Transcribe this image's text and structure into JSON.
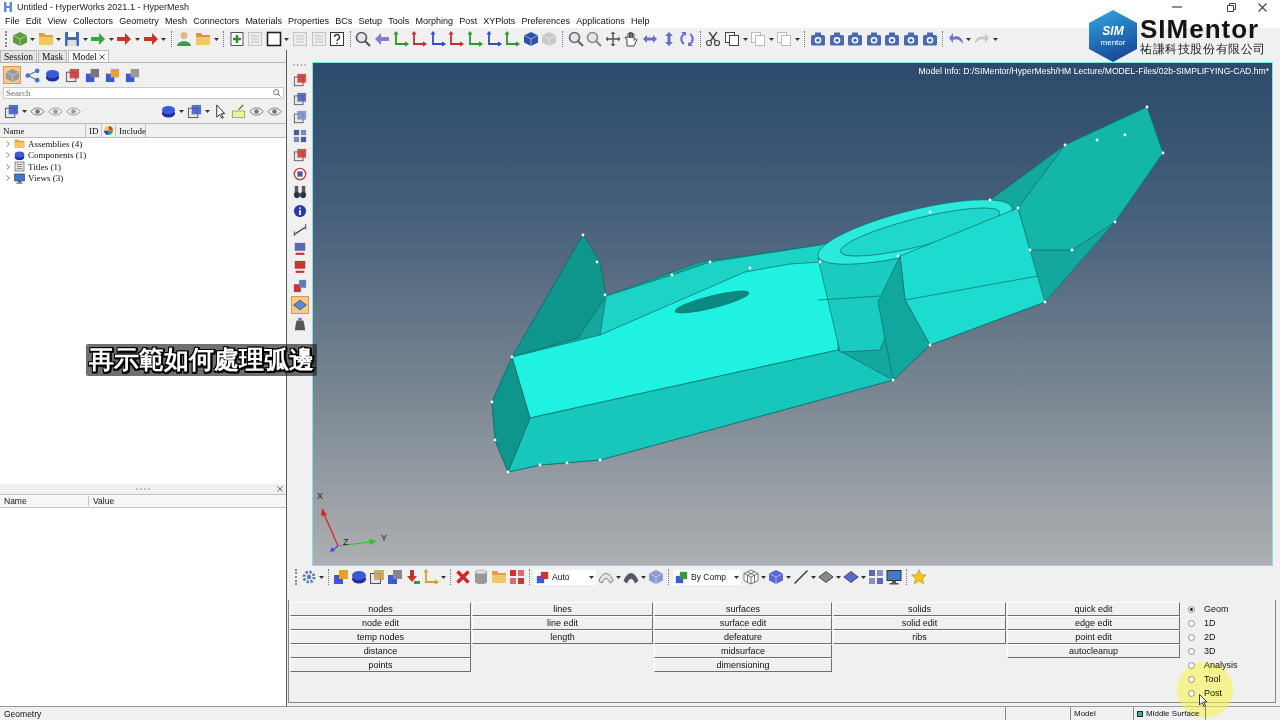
{
  "window": {
    "title": "Untitled - HyperWorks 2021.1 - HyperMesh"
  },
  "menu_bar": [
    "File",
    "Edit",
    "View",
    "Collectors",
    "Geometry",
    "Mesh",
    "Connectors",
    "Materials",
    "Properties",
    "BCs",
    "Setup",
    "Tools",
    "Morphing",
    "Post",
    "XYPlots",
    "Preferences",
    "Applications",
    "Help"
  ],
  "browser": {
    "tabs": [
      {
        "label": "Session",
        "selected": false,
        "closable": false
      },
      {
        "label": "Mask",
        "selected": false,
        "closable": false
      },
      {
        "label": "Model",
        "selected": true,
        "closable": true
      }
    ],
    "view_buttons": [
      {
        "selected": true
      },
      {
        "selected": false
      },
      {
        "selected": false
      },
      {
        "selected": false
      },
      {
        "selected": false
      },
      {
        "selected": false
      },
      {
        "selected": false
      }
    ],
    "search": {
      "placeholder": "Search"
    },
    "columns": [
      "Name",
      "ID",
      "Include"
    ],
    "tree": [
      {
        "label": "Assemblies (4)",
        "kind": "assembly",
        "expanded": false
      },
      {
        "label": "Components (1)",
        "kind": "component",
        "expanded": false
      },
      {
        "label": "Titles (1)",
        "kind": "title",
        "expanded": false
      },
      {
        "label": "Views (3)",
        "kind": "view",
        "expanded": false
      }
    ],
    "properties_columns": [
      "Name",
      "Value"
    ]
  },
  "vertical_toolbar": [
    {
      "selected": false
    },
    {
      "selected": false
    },
    {
      "selected": false
    },
    {
      "selected": false
    },
    {
      "selected": false
    },
    {
      "selected": false
    },
    {
      "selected": false
    },
    {
      "selected": false
    },
    {
      "selected": false
    },
    {
      "selected": false
    },
    {
      "selected": false
    },
    {
      "selected": false
    },
    {
      "selected": true
    },
    {
      "selected": false
    }
  ],
  "graphics": {
    "model_info": "Model Info: D:/SIMentor/HyperMesh/HM Lecture/MODEL-Files/02b-SIMPLIFYING-CAD.hm*",
    "axis_labels": [
      "X",
      "Z",
      "Y"
    ]
  },
  "bottom_toolbar": {
    "display_mode": "Auto",
    "color_mode": "By Comp"
  },
  "panel": {
    "columns": [
      [
        "nodes",
        "node edit",
        "temp nodes",
        "distance",
        "points"
      ],
      [
        "lines",
        "line edit",
        "length"
      ],
      [
        "surfaces",
        "surface edit",
        "defeature",
        "midsurface",
        "dimensioning"
      ],
      [
        "solids",
        "solid edit",
        "ribs"
      ],
      [
        "quick edit",
        "edge edit",
        "point edit",
        "autocleanup"
      ]
    ],
    "pages": [
      {
        "label": "Geom",
        "selected": true
      },
      {
        "label": "1D",
        "selected": false
      },
      {
        "label": "2D",
        "selected": false
      },
      {
        "label": "3D",
        "selected": false
      },
      {
        "label": "Analysis",
        "selected": false
      },
      {
        "label": "Tool",
        "selected": false
      },
      {
        "label": "Post",
        "selected": false
      }
    ]
  },
  "status_bar": {
    "message": "Geometry",
    "collector": "Model",
    "component": "Middle Surface"
  },
  "overlay": {
    "subtitle": "再示範如何處理弧邊",
    "logo": {
      "emblem": "SIM",
      "emblem_caption": "mentor",
      "name": "SIMentor",
      "company": "祐謙科技股份有限公司"
    }
  }
}
